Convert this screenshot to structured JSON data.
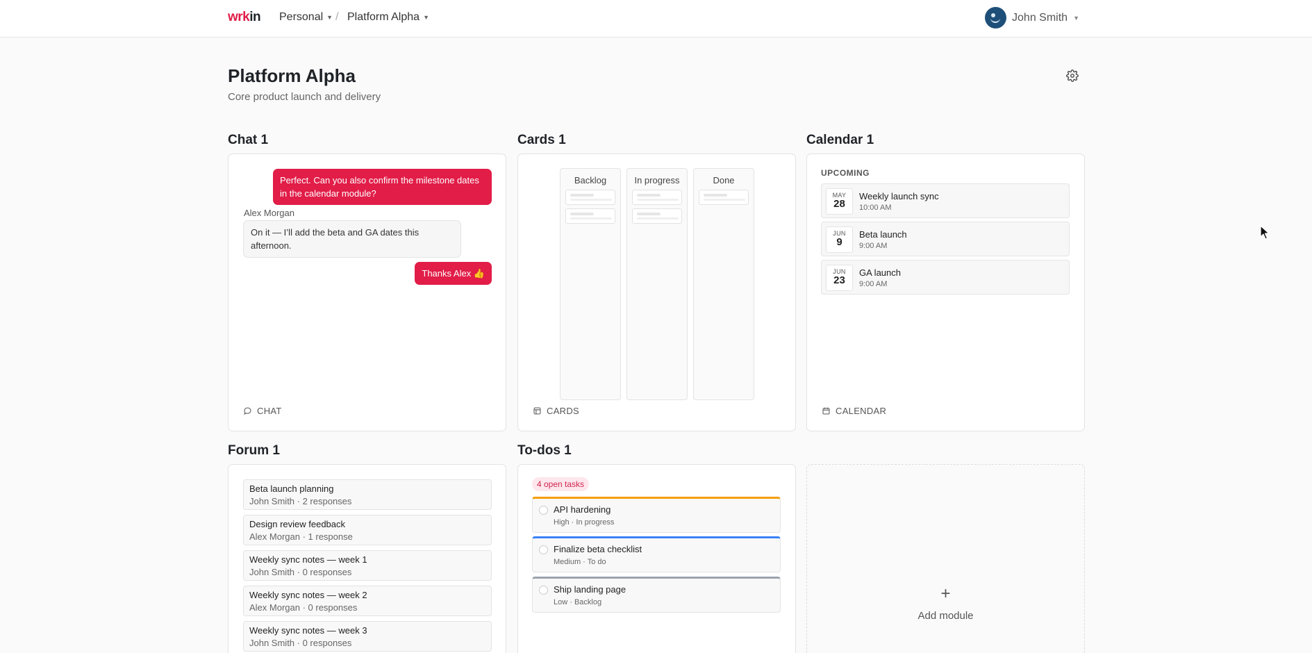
{
  "app": {
    "logo_w": "wrk",
    "logo_k": "in",
    "breadcrumb": [
      "Personal",
      "Platform Alpha"
    ],
    "breadcrumb_sep": "/",
    "user_name": "John Smith"
  },
  "page": {
    "title": "Platform Alpha",
    "subtitle": "Core product launch and delivery"
  },
  "chat": {
    "title": "Chat 1",
    "messages": [
      {
        "text": "Perfect. Can you also confirm the milestone dates in the calendar module?"
      },
      {
        "author": "Alex Morgan",
        "text": "On it — I’ll add the beta and GA dates this afternoon."
      },
      {
        "text": "Thanks Alex 👍"
      }
    ],
    "footer": "CHAT"
  },
  "cards": {
    "title": "Cards 1",
    "columns": [
      {
        "label": "Backlog",
        "cards": 2
      },
      {
        "label": "In progress",
        "cards": 2
      },
      {
        "label": "Done",
        "cards": 1
      }
    ],
    "footer": "CARDS"
  },
  "calendar": {
    "title": "Calendar 1",
    "section": "UPCOMING",
    "events": [
      {
        "month": "MAY",
        "day": "28",
        "name": "Weekly launch sync",
        "time": "10:00 AM"
      },
      {
        "month": "JUN",
        "day": "9",
        "name": "Beta launch",
        "time": "9:00 AM"
      },
      {
        "month": "JUN",
        "day": "23",
        "name": "GA launch",
        "time": "9:00 AM"
      }
    ],
    "footer": "CALENDAR"
  },
  "forum": {
    "title": "Forum 1",
    "threads": [
      {
        "title": "Beta launch planning",
        "meta": "John Smith · 2 responses"
      },
      {
        "title": "Design review feedback",
        "meta": "Alex Morgan · 1 response"
      },
      {
        "title": "Weekly sync notes — week 1",
        "meta": "John Smith · 0 responses"
      },
      {
        "title": "Weekly sync notes — week 2",
        "meta": "Alex Morgan · 0 responses"
      },
      {
        "title": "Weekly sync notes — week 3",
        "meta": "John Smith · 0 responses"
      }
    ]
  },
  "todos": {
    "title": "To-dos 1",
    "badge": "4 open tasks",
    "items": [
      {
        "name": "API hardening",
        "meta": "High · In progress",
        "color": "#f59e0b"
      },
      {
        "name": "Finalize beta checklist",
        "meta": "Medium · To do",
        "color": "#3b82f6"
      },
      {
        "name": "Ship landing page",
        "meta": "Low · Backlog",
        "color": "#9ca3af"
      }
    ]
  },
  "add_module": {
    "plus": "+",
    "label": "Add module"
  },
  "colors": {
    "accent": "#e11d48"
  }
}
